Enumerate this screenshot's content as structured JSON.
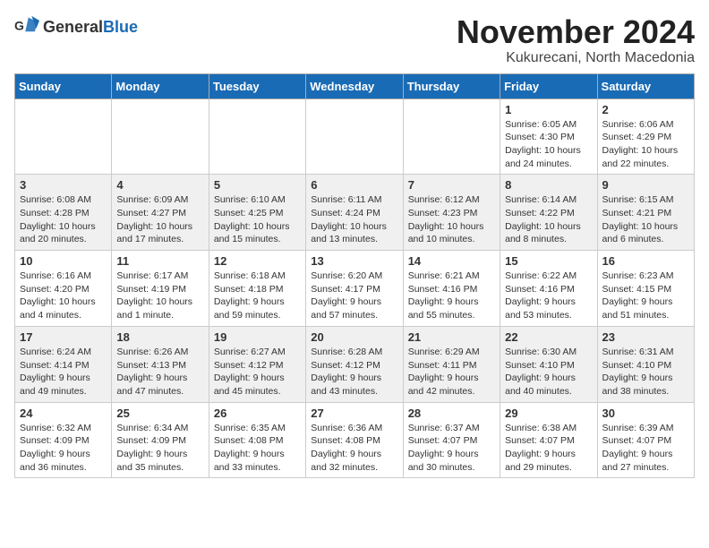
{
  "logo": {
    "general": "General",
    "blue": "Blue"
  },
  "header": {
    "month": "November 2024",
    "location": "Kukurecani, North Macedonia"
  },
  "weekdays": [
    "Sunday",
    "Monday",
    "Tuesday",
    "Wednesday",
    "Thursday",
    "Friday",
    "Saturday"
  ],
  "weeks": [
    [
      {
        "day": "",
        "info": ""
      },
      {
        "day": "",
        "info": ""
      },
      {
        "day": "",
        "info": ""
      },
      {
        "day": "",
        "info": ""
      },
      {
        "day": "",
        "info": ""
      },
      {
        "day": "1",
        "info": "Sunrise: 6:05 AM\nSunset: 4:30 PM\nDaylight: 10 hours and 24 minutes."
      },
      {
        "day": "2",
        "info": "Sunrise: 6:06 AM\nSunset: 4:29 PM\nDaylight: 10 hours and 22 minutes."
      }
    ],
    [
      {
        "day": "3",
        "info": "Sunrise: 6:08 AM\nSunset: 4:28 PM\nDaylight: 10 hours and 20 minutes."
      },
      {
        "day": "4",
        "info": "Sunrise: 6:09 AM\nSunset: 4:27 PM\nDaylight: 10 hours and 17 minutes."
      },
      {
        "day": "5",
        "info": "Sunrise: 6:10 AM\nSunset: 4:25 PM\nDaylight: 10 hours and 15 minutes."
      },
      {
        "day": "6",
        "info": "Sunrise: 6:11 AM\nSunset: 4:24 PM\nDaylight: 10 hours and 13 minutes."
      },
      {
        "day": "7",
        "info": "Sunrise: 6:12 AM\nSunset: 4:23 PM\nDaylight: 10 hours and 10 minutes."
      },
      {
        "day": "8",
        "info": "Sunrise: 6:14 AM\nSunset: 4:22 PM\nDaylight: 10 hours and 8 minutes."
      },
      {
        "day": "9",
        "info": "Sunrise: 6:15 AM\nSunset: 4:21 PM\nDaylight: 10 hours and 6 minutes."
      }
    ],
    [
      {
        "day": "10",
        "info": "Sunrise: 6:16 AM\nSunset: 4:20 PM\nDaylight: 10 hours and 4 minutes."
      },
      {
        "day": "11",
        "info": "Sunrise: 6:17 AM\nSunset: 4:19 PM\nDaylight: 10 hours and 1 minute."
      },
      {
        "day": "12",
        "info": "Sunrise: 6:18 AM\nSunset: 4:18 PM\nDaylight: 9 hours and 59 minutes."
      },
      {
        "day": "13",
        "info": "Sunrise: 6:20 AM\nSunset: 4:17 PM\nDaylight: 9 hours and 57 minutes."
      },
      {
        "day": "14",
        "info": "Sunrise: 6:21 AM\nSunset: 4:16 PM\nDaylight: 9 hours and 55 minutes."
      },
      {
        "day": "15",
        "info": "Sunrise: 6:22 AM\nSunset: 4:16 PM\nDaylight: 9 hours and 53 minutes."
      },
      {
        "day": "16",
        "info": "Sunrise: 6:23 AM\nSunset: 4:15 PM\nDaylight: 9 hours and 51 minutes."
      }
    ],
    [
      {
        "day": "17",
        "info": "Sunrise: 6:24 AM\nSunset: 4:14 PM\nDaylight: 9 hours and 49 minutes."
      },
      {
        "day": "18",
        "info": "Sunrise: 6:26 AM\nSunset: 4:13 PM\nDaylight: 9 hours and 47 minutes."
      },
      {
        "day": "19",
        "info": "Sunrise: 6:27 AM\nSunset: 4:12 PM\nDaylight: 9 hours and 45 minutes."
      },
      {
        "day": "20",
        "info": "Sunrise: 6:28 AM\nSunset: 4:12 PM\nDaylight: 9 hours and 43 minutes."
      },
      {
        "day": "21",
        "info": "Sunrise: 6:29 AM\nSunset: 4:11 PM\nDaylight: 9 hours and 42 minutes."
      },
      {
        "day": "22",
        "info": "Sunrise: 6:30 AM\nSunset: 4:10 PM\nDaylight: 9 hours and 40 minutes."
      },
      {
        "day": "23",
        "info": "Sunrise: 6:31 AM\nSunset: 4:10 PM\nDaylight: 9 hours and 38 minutes."
      }
    ],
    [
      {
        "day": "24",
        "info": "Sunrise: 6:32 AM\nSunset: 4:09 PM\nDaylight: 9 hours and 36 minutes."
      },
      {
        "day": "25",
        "info": "Sunrise: 6:34 AM\nSunset: 4:09 PM\nDaylight: 9 hours and 35 minutes."
      },
      {
        "day": "26",
        "info": "Sunrise: 6:35 AM\nSunset: 4:08 PM\nDaylight: 9 hours and 33 minutes."
      },
      {
        "day": "27",
        "info": "Sunrise: 6:36 AM\nSunset: 4:08 PM\nDaylight: 9 hours and 32 minutes."
      },
      {
        "day": "28",
        "info": "Sunrise: 6:37 AM\nSunset: 4:07 PM\nDaylight: 9 hours and 30 minutes."
      },
      {
        "day": "29",
        "info": "Sunrise: 6:38 AM\nSunset: 4:07 PM\nDaylight: 9 hours and 29 minutes."
      },
      {
        "day": "30",
        "info": "Sunrise: 6:39 AM\nSunset: 4:07 PM\nDaylight: 9 hours and 27 minutes."
      }
    ]
  ]
}
